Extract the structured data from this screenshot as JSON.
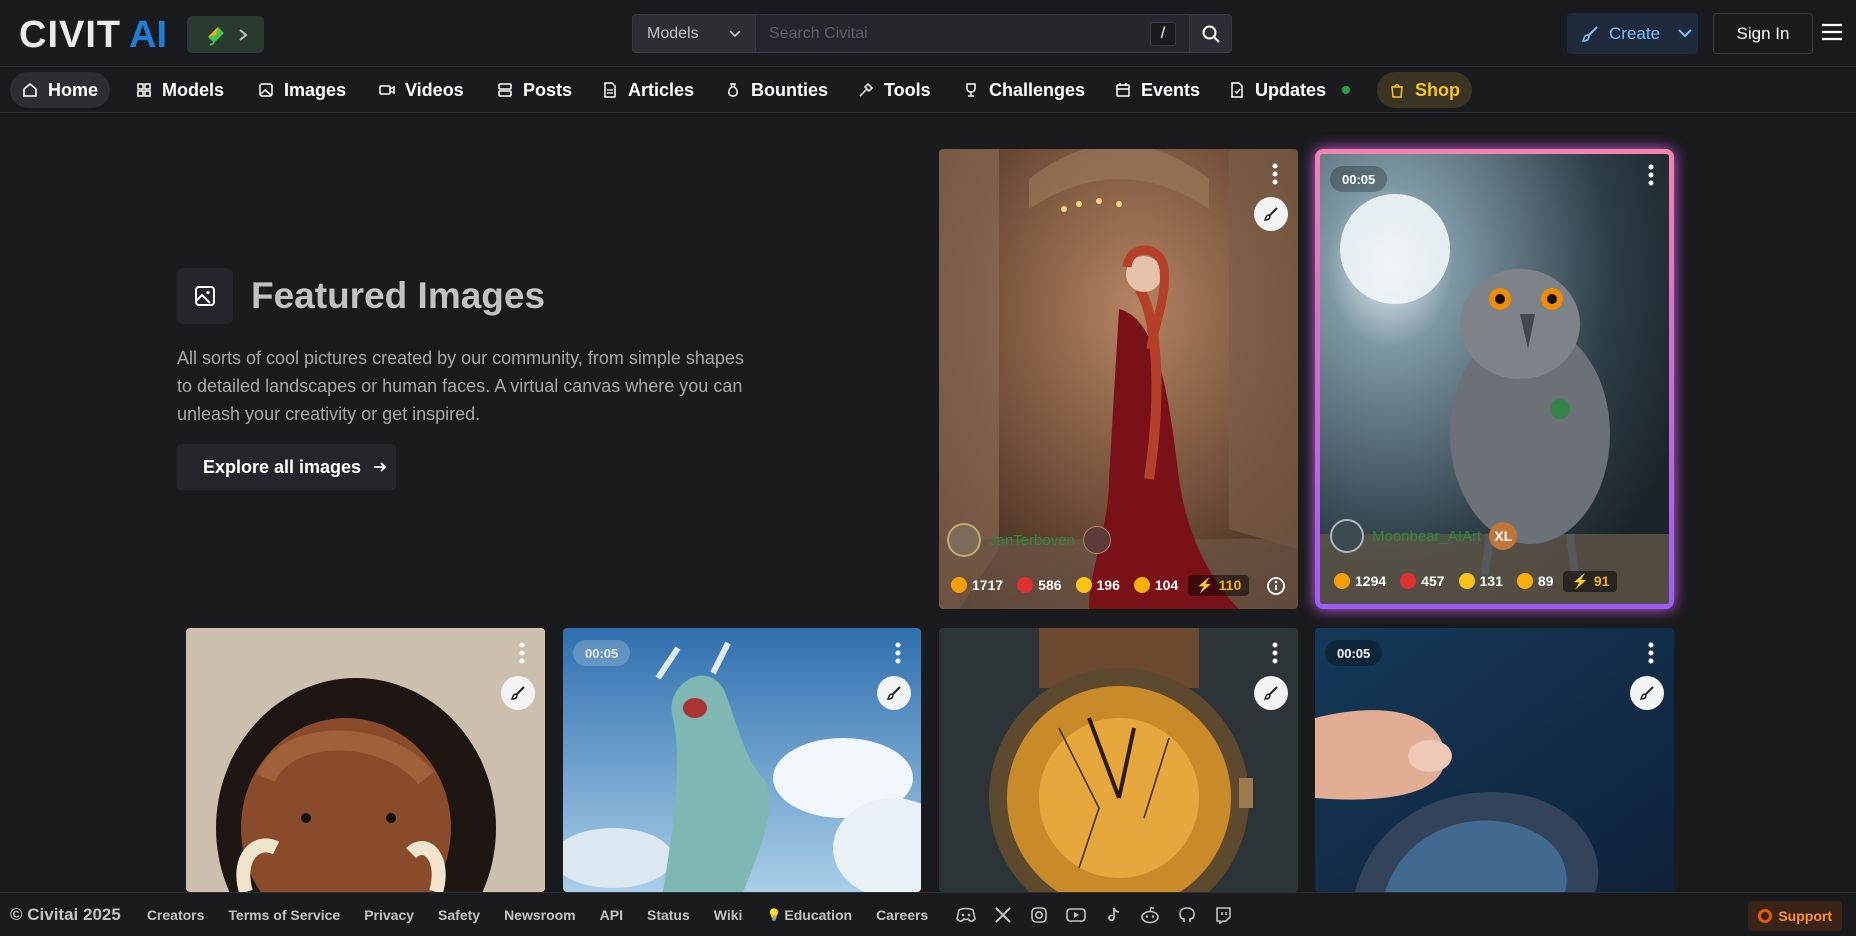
{
  "header": {
    "logo_text": "CIVITAI",
    "search": {
      "scope_value": "Models",
      "placeholder": "Search Civitai",
      "shortcut_key": "/"
    },
    "create_label": "Create",
    "signin_label": "Sign In"
  },
  "nav": {
    "items": [
      {
        "label": "Home",
        "icon": "home-icon",
        "active": true
      },
      {
        "label": "Models",
        "icon": "grid-icon"
      },
      {
        "label": "Images",
        "icon": "image-icon"
      },
      {
        "label": "Videos",
        "icon": "video-icon"
      },
      {
        "label": "Posts",
        "icon": "layers-icon"
      },
      {
        "label": "Articles",
        "icon": "file-text-icon"
      },
      {
        "label": "Bounties",
        "icon": "moneybag-icon"
      },
      {
        "label": "Tools",
        "icon": "tools-icon"
      },
      {
        "label": "Challenges",
        "icon": "trophy-icon"
      },
      {
        "label": "Events",
        "icon": "calendar-icon"
      },
      {
        "label": "Updates",
        "icon": "updates-icon"
      },
      {
        "label": "Shop",
        "icon": "shopping-bag-icon"
      }
    ]
  },
  "hero": {
    "title": "Featured Images",
    "description": "All sorts of cool pictures created by our community, from simple shapes to detailed landscapes or human faces. A virtual canvas where you can unleash your creativity or get inspired.",
    "cta_label": "Explore all images"
  },
  "cards": {
    "top1": {
      "username": "JanTerboven",
      "stats": {
        "like": "1717",
        "heart": "586",
        "laugh": "196",
        "cry": "104",
        "buzz": "110"
      }
    },
    "top2": {
      "duration": "00:05",
      "username": "Moonbear_AIArt",
      "badge": "XL",
      "stats": {
        "like": "1294",
        "heart": "457",
        "laugh": "131",
        "cry": "89",
        "buzz": "91"
      }
    },
    "bottom2": {
      "duration": "00:05"
    },
    "bottom4": {
      "duration": "00:05"
    }
  },
  "footer": {
    "copyright": "© Civitai 2025",
    "links": [
      "Creators",
      "Terms of Service",
      "Privacy",
      "Safety",
      "Newsroom",
      "API",
      "Status",
      "Wiki",
      "Education",
      "Careers"
    ],
    "support_label": "Support"
  },
  "colors": {
    "background": "#1a1b1e",
    "accent_blue": "#74c0fc",
    "shop_yellow": "#fcc419",
    "username_green": "#2b8a3e",
    "buzz_yellow": "#fab005"
  }
}
